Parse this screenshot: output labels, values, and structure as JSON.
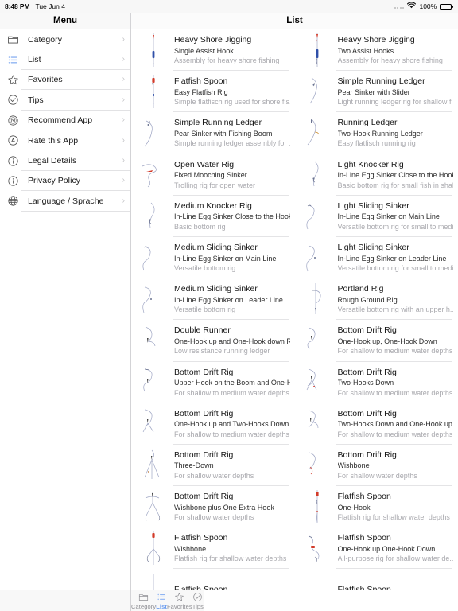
{
  "status_bar": {
    "time": "8:48 PM",
    "date": "Tue Jun 4",
    "battery_percent": "100%",
    "wifi_icon": "wifi-icon",
    "battery_icon": "battery-full-icon",
    "signal_icon": "signal-dots-icon"
  },
  "sidebar": {
    "title": "Menu",
    "items": [
      {
        "label": "Category",
        "icon": "folder-icon",
        "accent": false
      },
      {
        "label": "List",
        "icon": "list-icon",
        "accent": true
      },
      {
        "label": "Favorites",
        "icon": "star-icon",
        "accent": false
      },
      {
        "label": "Tips",
        "icon": "check-circle-icon",
        "accent": false
      },
      {
        "label": "Recommend App",
        "icon": "recommend-icon",
        "accent": false
      },
      {
        "label": "Rate this App",
        "icon": "rate-circle-icon",
        "accent": false
      },
      {
        "label": "Legal Details",
        "icon": "info-circle-icon",
        "accent": false
      },
      {
        "label": "Privacy Policy",
        "icon": "info-circle-icon",
        "accent": false
      },
      {
        "label": "Language / Sprache",
        "icon": "globe-icon",
        "accent": false
      }
    ],
    "chevron": "›"
  },
  "detail": {
    "title": "List",
    "rows": [
      [
        {
          "title": "Heavy Shore Jigging",
          "subtitle": "Single Assist Hook",
          "description": "Assembly for heavy shore fishing",
          "thumb": "jig-single-assist"
        },
        {
          "title": "Heavy Shore Jigging",
          "subtitle": "Two Assist Hooks",
          "description": "Assembly for heavy shore fishing",
          "thumb": "jig-two-assist"
        }
      ],
      [
        {
          "title": "Flatfish Spoon",
          "subtitle": "Easy Flatfish Rig",
          "description": "Simple flatfisch rig used for shore fis...",
          "thumb": "flatfish-easy"
        },
        {
          "title": "Simple Running Ledger",
          "subtitle": "Pear Sinker with Slider",
          "description": "Light running ledger rig for shallow fi...",
          "thumb": "ledger-slider"
        }
      ],
      [
        {
          "title": "Simple Running Ledger",
          "subtitle": "Pear Sinker with Fishing Boom",
          "description": "Simple running ledger assembly for ...",
          "thumb": "ledger-boom"
        },
        {
          "title": "Running Ledger",
          "subtitle": "Two-Hook Running Ledger",
          "description": "Easy flatfisch running rig",
          "thumb": "ledger-twohook"
        }
      ],
      [
        {
          "title": "Open Water Rig",
          "subtitle": "Fixed Mooching Sinker",
          "description": "Trolling rig for open water",
          "thumb": "mooching"
        },
        {
          "title": "Light Knocker Rig",
          "subtitle": "In-Line Egg Sinker Close to the Hook",
          "description": "Basic bottom rig for small fish in shal...",
          "thumb": "knocker-light"
        }
      ],
      [
        {
          "title": "Medium Knocker Rig",
          "subtitle": "In-Line Egg Sinker Close to the Hook",
          "description": "Basic bottom rig",
          "thumb": "knocker-medium"
        },
        {
          "title": "Light Sliding Sinker",
          "subtitle": "In-Line Egg Sinker on Main Line",
          "description": "Versatile bottom rig for small to medi...",
          "thumb": "sliding-light-main"
        }
      ],
      [
        {
          "title": "Medium Sliding Sinker",
          "subtitle": "In-Line Egg Sinker on Main Line",
          "description": "Versatile bottom rig",
          "thumb": "sliding-med-main"
        },
        {
          "title": "Light Sliding Sinker",
          "subtitle": "In-Line Egg Sinker on Leader Line",
          "description": "Versatile bottom rig for small to medi...",
          "thumb": "sliding-light-leader"
        }
      ],
      [
        {
          "title": "Medium Sliding Sinker",
          "subtitle": "In-Line Egg Sinker on Leader Line",
          "description": "Versatile bottom rig",
          "thumb": "sliding-med-leader"
        },
        {
          "title": "Portland Rig",
          "subtitle": "Rough Ground Rig",
          "description": "Versatile bottom rig with an upper h...",
          "thumb": "portland"
        }
      ],
      [
        {
          "title": "Double Runner",
          "subtitle": "One-Hook up and One-Hook down Rur",
          "description": "Low resistance running ledger",
          "thumb": "double-runner"
        },
        {
          "title": "Bottom Drift Rig",
          "subtitle": "One-Hook up, One-Hook Down",
          "description": "For shallow to medium water depths",
          "thumb": "drift-one-one"
        }
      ],
      [
        {
          "title": "Bottom Drift Rig",
          "subtitle": "Upper Hook on the Boom and One-Hoc",
          "description": "For shallow to medium water depths",
          "thumb": "drift-boom"
        },
        {
          "title": "Bottom Drift Rig",
          "subtitle": "Two-Hooks Down",
          "description": "For shallow to medium water depths",
          "thumb": "drift-two-down"
        }
      ],
      [
        {
          "title": "Bottom Drift Rig",
          "subtitle": "One-Hook up and Two-Hooks Down",
          "description": "For shallow to medium water depths",
          "thumb": "drift-one-two"
        },
        {
          "title": "Bottom Drift Rig",
          "subtitle": "Two-Hooks Down and One-Hook up or",
          "description": "For shallow to medium water depths",
          "thumb": "drift-two-one"
        }
      ],
      [
        {
          "title": "Bottom Drift Rig",
          "subtitle": "Three-Down",
          "description": "For shallow water depths",
          "thumb": "drift-three-down"
        },
        {
          "title": "Bottom Drift Rig",
          "subtitle": "Wishbone",
          "description": "For shallow water depths",
          "thumb": "drift-wishbone"
        }
      ],
      [
        {
          "title": "Bottom Drift Rig",
          "subtitle": "Wishbone plus One Extra Hook",
          "description": "For shallow water depths",
          "thumb": "drift-wishbone-extra"
        },
        {
          "title": "Flatfish Spoon",
          "subtitle": "One-Hook",
          "description": "Flatfish rig for shallow water depths",
          "thumb": "flatfish-one"
        }
      ],
      [
        {
          "title": "Flatfish Spoon",
          "subtitle": "Wishbone",
          "description": "Flatfish rig for shallow water depths",
          "thumb": "flatfish-wishbone"
        },
        {
          "title": "Flatfish Spoon",
          "subtitle": "One-Hook up One-Hook Down",
          "description": "All-purpose rig for shallow water de...",
          "thumb": "flatfish-one-one"
        }
      ],
      [
        {
          "title": "Flatfish Spoon",
          "subtitle": "",
          "description": "",
          "thumb": "flatfish-partial"
        },
        {
          "title": "Flatfish Spoon",
          "subtitle": "",
          "description": "",
          "thumb": "flatfish-partial2"
        }
      ]
    ]
  },
  "tabbar": {
    "tabs": [
      {
        "label": "Category",
        "icon": "folder-icon",
        "active": false
      },
      {
        "label": "List",
        "icon": "list-icon",
        "active": true
      },
      {
        "label": "Favorites",
        "icon": "star-icon",
        "active": false
      },
      {
        "label": "Tips",
        "icon": "check-circle-icon",
        "active": false
      }
    ]
  },
  "colors": {
    "accent": "#6f9ff0",
    "inactive": "#8e8e93",
    "separator": "#e4e4e6",
    "bar_background": "#f8f8f8"
  }
}
